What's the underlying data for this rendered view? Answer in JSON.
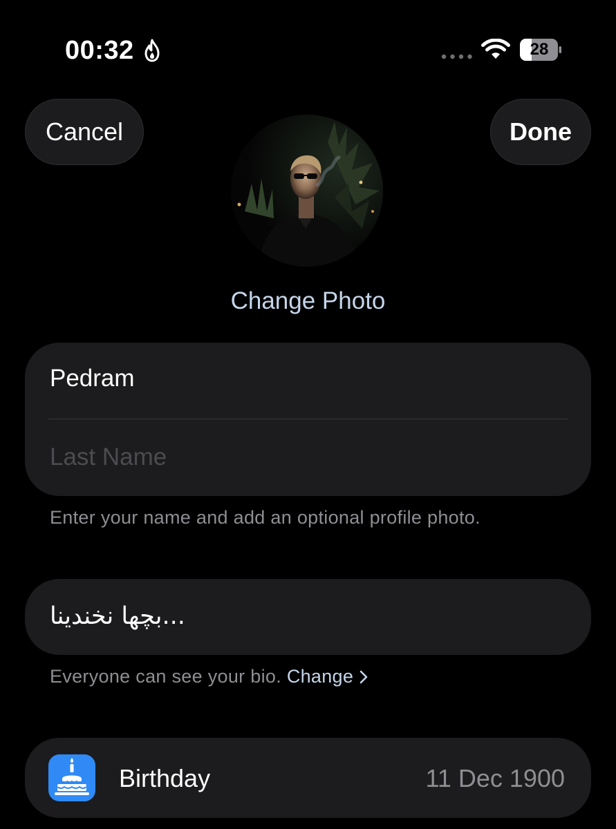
{
  "status_bar": {
    "time": "00:32",
    "battery_level": "28",
    "icons": [
      "flame-icon",
      "signal-dots-icon",
      "wifi-icon",
      "battery-icon"
    ]
  },
  "nav": {
    "cancel_label": "Cancel",
    "done_label": "Done"
  },
  "profile": {
    "change_photo_label": "Change Photo"
  },
  "name_section": {
    "first_name_value": "Pedram",
    "last_name_placeholder": "Last Name",
    "footnote": "Enter your name and add an optional profile photo."
  },
  "bio_section": {
    "bio_value": "بچها نخندینا...",
    "footnote_prefix": "Everyone can see your bio.",
    "change_link": "Change"
  },
  "birthday_section": {
    "label": "Birthday",
    "value": "11 Dec 1900",
    "icon": "cake-icon"
  },
  "colors": {
    "background": "#000000",
    "card": "#1c1c1e",
    "accent_link": "#c5d5ea",
    "secondary_text": "#8e8e93",
    "icon_tile": "#2f8af5"
  }
}
